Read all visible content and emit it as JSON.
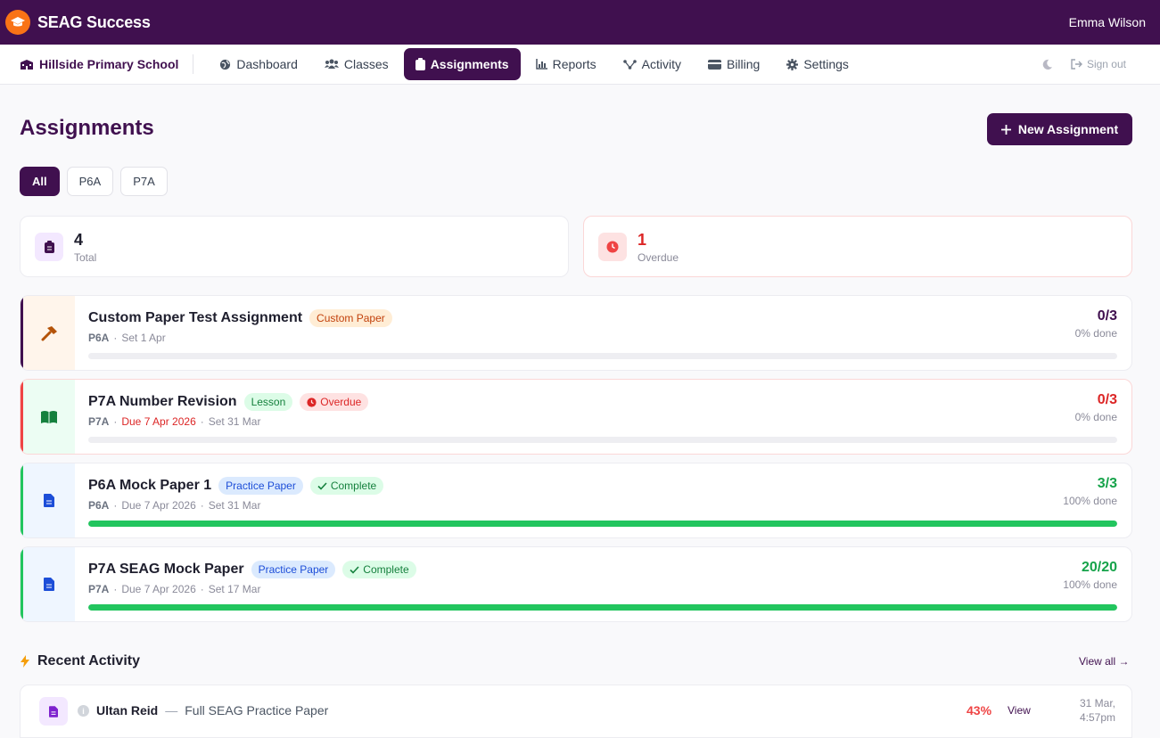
{
  "app": {
    "brand": "SEAG Success",
    "user": "Emma Wilson"
  },
  "nav": {
    "school": "Hillside Primary School",
    "items": [
      {
        "label": "Dashboard",
        "icon": "globe-icon"
      },
      {
        "label": "Classes",
        "icon": "users-icon"
      },
      {
        "label": "Assignments",
        "icon": "clipboard-icon",
        "active": true
      },
      {
        "label": "Reports",
        "icon": "chart-icon"
      },
      {
        "label": "Activity",
        "icon": "activity-icon"
      },
      {
        "label": "Billing",
        "icon": "credit-card-icon"
      },
      {
        "label": "Settings",
        "icon": "gear-icon"
      }
    ],
    "signout": "Sign out"
  },
  "page": {
    "title": "Assignments",
    "new_button": "New Assignment"
  },
  "filters": [
    "All",
    "P6A",
    "P7A"
  ],
  "stats": {
    "total": {
      "value": "4",
      "label": "Total"
    },
    "overdue": {
      "value": "1",
      "label": "Overdue"
    }
  },
  "assignments": [
    {
      "title": "Custom Paper Test Assignment",
      "type": "Custom Paper",
      "status": "",
      "class": "P6A",
      "due": "",
      "set": "Set 1 Apr",
      "count": "0/3",
      "done": "0% done",
      "progress": 0,
      "icon": "hammer-icon",
      "accent": "#40104f"
    },
    {
      "title": "P7A Number Revision",
      "type": "Lesson",
      "status": "Overdue",
      "class": "P7A",
      "due": "Due 7 Apr 2026",
      "set": "Set 31 Mar",
      "count": "0/3",
      "done": "0% done",
      "progress": 0,
      "icon": "book-icon",
      "accent": "#ef4444"
    },
    {
      "title": "P6A Mock Paper 1",
      "type": "Practice Paper",
      "status": "Complete",
      "class": "P6A",
      "due": "Due 7 Apr 2026",
      "set": "Set 31 Mar",
      "count": "3/3",
      "done": "100% done",
      "progress": 1,
      "icon": "document-icon",
      "accent": "#22c55e"
    },
    {
      "title": "P7A SEAG Mock Paper",
      "type": "Practice Paper",
      "status": "Complete",
      "class": "P7A",
      "due": "Due 7 Apr 2026",
      "set": "Set 17 Mar",
      "count": "20/20",
      "done": "100% done",
      "progress": 1,
      "icon": "document-icon",
      "accent": "#22c55e"
    }
  ],
  "recent": {
    "title": "Recent Activity",
    "view_all": "View all →",
    "items": [
      {
        "avatar": "i",
        "name": "Ultan Reid",
        "paper": "Full SEAG Practice Paper",
        "score": "43%",
        "view": "View",
        "date": "31 Mar,",
        "time": "4:57pm"
      }
    ]
  },
  "sep": "·",
  "dash": "—"
}
